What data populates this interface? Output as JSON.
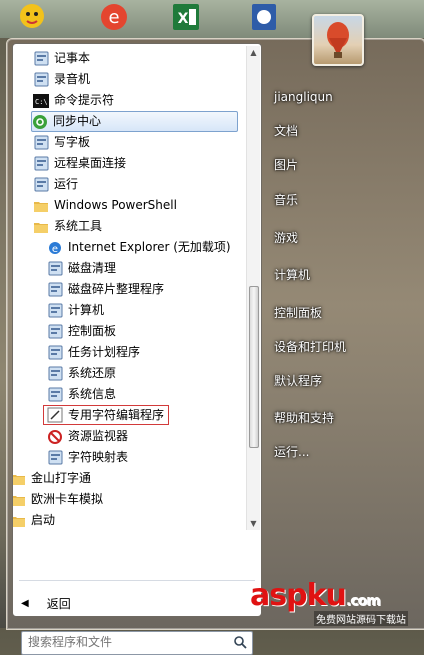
{
  "menu": {
    "items": [
      {
        "label": "记事本",
        "icon": "notepad-icon",
        "indent": 0
      },
      {
        "label": "录音机",
        "icon": "microphone-icon",
        "indent": 0
      },
      {
        "label": "命令提示符",
        "icon": "cmd-icon",
        "indent": 0
      },
      {
        "label": "同步中心",
        "icon": "sync-center-icon",
        "indent": 0,
        "highlight": true
      },
      {
        "label": "写字板",
        "icon": "wordpad-icon",
        "indent": 0
      },
      {
        "label": "远程桌面连接",
        "icon": "remote-desktop-icon",
        "indent": 0
      },
      {
        "label": "运行",
        "icon": "run-icon",
        "indent": 0
      },
      {
        "label": "Windows PowerShell",
        "icon": "folder-icon",
        "indent": 0
      },
      {
        "label": "系统工具",
        "icon": "folder-icon",
        "indent": 0
      },
      {
        "label": "Internet Explorer (无加载项)",
        "icon": "ie-icon",
        "indent": 1
      },
      {
        "label": "磁盘清理",
        "icon": "disk-cleanup-icon",
        "indent": 1
      },
      {
        "label": "磁盘碎片整理程序",
        "icon": "defrag-icon",
        "indent": 1
      },
      {
        "label": "计算机",
        "icon": "computer-icon",
        "indent": 1
      },
      {
        "label": "控制面板",
        "icon": "control-panel-icon",
        "indent": 1
      },
      {
        "label": "任务计划程序",
        "icon": "task-scheduler-icon",
        "indent": 1
      },
      {
        "label": "系统还原",
        "icon": "system-restore-icon",
        "indent": 1
      },
      {
        "label": "系统信息",
        "icon": "system-info-icon",
        "indent": 1
      },
      {
        "label": "专用字符编辑程序",
        "icon": "char-editor-icon",
        "indent": 1,
        "boxed": true
      },
      {
        "label": "资源监视器",
        "icon": "resource-monitor-icon",
        "indent": 1
      },
      {
        "label": "字符映射表",
        "icon": "charmap-icon",
        "indent": 1
      },
      {
        "label": "金山打字通",
        "icon": "folder-icon",
        "indent": -1
      },
      {
        "label": "欧洲卡车模拟",
        "icon": "folder-icon",
        "indent": -1
      },
      {
        "label": "启动",
        "icon": "folder-icon",
        "indent": -1
      }
    ],
    "back_label": "返回",
    "search_placeholder": "搜索程序和文件"
  },
  "right": {
    "items": [
      "jiangliqun",
      "文档",
      "图片",
      "音乐",
      "游戏",
      "计算机",
      "控制面板",
      "设备和打印机",
      "默认程序",
      "帮助和支持",
      "运行..."
    ]
  },
  "watermark": {
    "brand": "aspku",
    "tld": ".com",
    "tagline": "免费网站源码下载站"
  },
  "colors": {
    "highlight_border": "#7da2ce",
    "red_box": "#d23a3a",
    "watermark": "#e01212"
  }
}
